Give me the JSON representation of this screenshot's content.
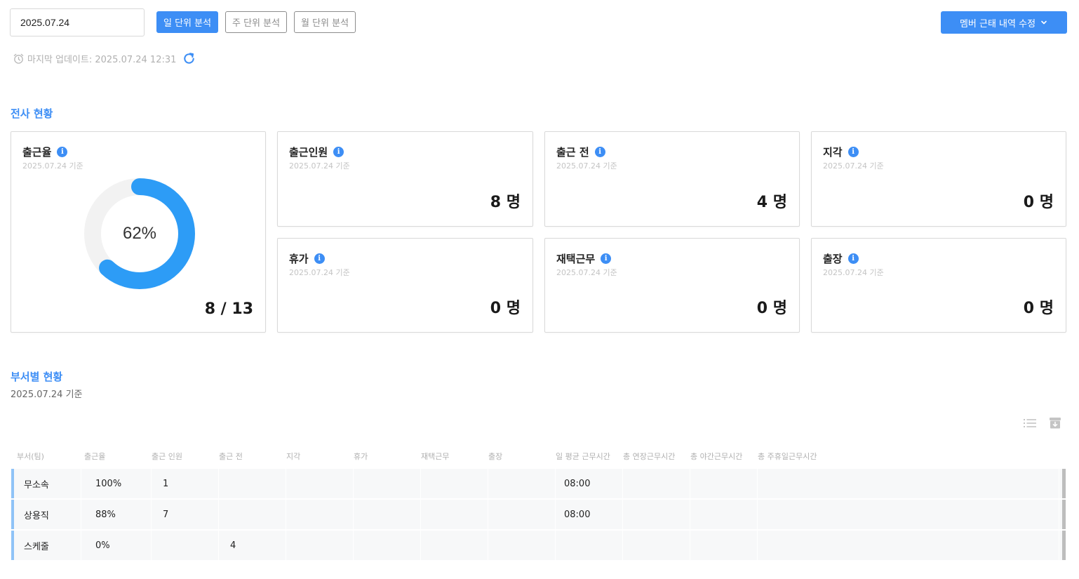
{
  "toolbar": {
    "date_value": "2025.07.24",
    "tabs": [
      "일 단위 분석",
      "주 단위 분석",
      "월 단위 분석"
    ],
    "active_tab": "일 단위 분석",
    "edit_label": "멤버 근태 내역 수정"
  },
  "updated": {
    "text": "마지막 업데이트: 2025.07.24 12:31"
  },
  "company": {
    "title": "전사 현황",
    "attendance_rate": {
      "label": "출근율",
      "date": "2025.07.24 기준",
      "percent": 62,
      "percent_text": "62%",
      "value": "8 / 13"
    },
    "cards": [
      {
        "label": "출근인원",
        "date": "2025.07.24 기준",
        "value": "8 명"
      },
      {
        "label": "출근 전",
        "date": "2025.07.24 기준",
        "value": "4 명"
      },
      {
        "label": "지각",
        "date": "2025.07.24 기준",
        "value": "0 명"
      },
      {
        "label": "휴가",
        "date": "2025.07.24 기준",
        "value": "0 명"
      },
      {
        "label": "재택근무",
        "date": "2025.07.24 기준",
        "value": "0 명"
      },
      {
        "label": "출장",
        "date": "2025.07.24 기준",
        "value": "0 명"
      }
    ]
  },
  "departments": {
    "title": "부서별 현황",
    "subtitle": "2025.07.24 기준",
    "columns": [
      "부서(팀)",
      "출근율",
      "출근 인원",
      "출근 전",
      "지각",
      "휴가",
      "재택근무",
      "출장",
      "일 평균 근무시간",
      "총 연장근무시간",
      "총 야간근무시간",
      "총 주휴일근무시간"
    ],
    "rows": [
      [
        "무소속",
        "100%",
        "1",
        "",
        "",
        "",
        "",
        "",
        "08:00",
        "",
        "",
        ""
      ],
      [
        "상용직",
        "88%",
        "7",
        "",
        "",
        "",
        "",
        "",
        "08:00",
        "",
        "",
        ""
      ],
      [
        "스케줄",
        "0%",
        "",
        "4",
        "",
        "",
        "",
        "",
        "",
        "",
        "",
        ""
      ]
    ]
  },
  "colors": {
    "accent": "#3d8ef5",
    "donut_fill": "#2d9cf6",
    "donut_track": "#f2f2f2",
    "row_marker": "#8fc3f7"
  },
  "icons": {
    "clock": "alarm-clock-icon",
    "refresh": "refresh-icon",
    "info": "info-icon",
    "list": "list-icon",
    "download": "download-box-icon",
    "chevron": "chevron-down-icon"
  }
}
